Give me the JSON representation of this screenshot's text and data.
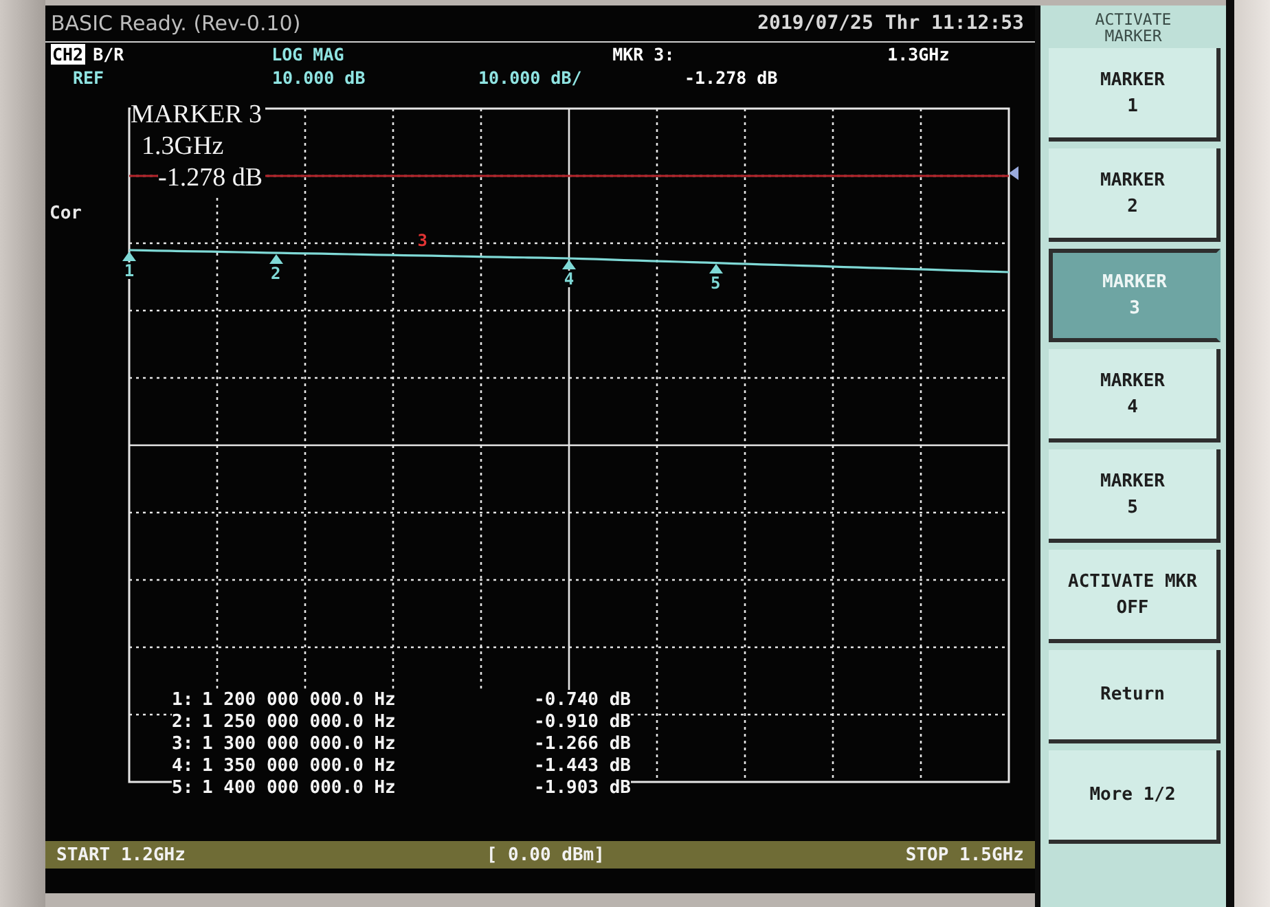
{
  "title_bar": {
    "status": "BASIC Ready. (Rev-0.10)",
    "datetime": "2019/07/25 Thr 11:12:53"
  },
  "header": {
    "channel": "CH2",
    "measurement": "B/R",
    "format": "LOG MAG",
    "marker_label": "MKR 3:",
    "marker_frequency": "1.3GHz",
    "reference": "REF",
    "reference_value": "10.000 dB",
    "scale": "10.000 dB/",
    "marker_value": "-1.278 dB"
  },
  "plot": {
    "side_label": "Cor",
    "marker_readout": [
      "MARKER 3",
      "1.3GHz",
      "-1.278 dB"
    ],
    "markers": [
      {
        "label": "1",
        "selected": false
      },
      {
        "label": "2",
        "selected": false
      },
      {
        "label": "3",
        "selected": true
      },
      {
        "label": "4",
        "selected": false
      },
      {
        "label": "5",
        "selected": false
      }
    ],
    "marker_table": [
      {
        "index": "1:",
        "frequency": "1 200 000 000.0 Hz",
        "value": "-0.740 dB"
      },
      {
        "index": "2:",
        "frequency": "1 250 000 000.0 Hz",
        "value": "-0.910 dB"
      },
      {
        "index": "3:",
        "frequency": "1 300 000 000.0 Hz",
        "value": "-1.266 dB"
      },
      {
        "index": "4:",
        "frequency": "1 350 000 000.0 Hz",
        "value": "-1.443 dB"
      },
      {
        "index": "5:",
        "frequency": "1 400 000 000.0 Hz",
        "value": "-1.903 dB"
      }
    ]
  },
  "footer": {
    "start": "START 1.2GHz",
    "power": "[ 0.00 dBm]",
    "stop": "STOP 1.5GHz"
  },
  "softkeys": {
    "title_lines": [
      "ACTIVATE",
      "MARKER"
    ],
    "buttons": [
      {
        "lines": [
          "MARKER",
          "1"
        ],
        "selected": false
      },
      {
        "lines": [
          "MARKER",
          "2"
        ],
        "selected": false
      },
      {
        "lines": [
          "MARKER",
          "3"
        ],
        "selected": true
      },
      {
        "lines": [
          "MARKER",
          "4"
        ],
        "selected": false
      },
      {
        "lines": [
          "MARKER",
          "5"
        ],
        "selected": false
      },
      {
        "lines": [
          "ACTIVATE MKR",
          "OFF"
        ],
        "selected": false
      },
      {
        "lines": [
          "Return"
        ],
        "selected": false
      },
      {
        "lines": [
          "More 1/2"
        ],
        "selected": false
      }
    ]
  }
}
